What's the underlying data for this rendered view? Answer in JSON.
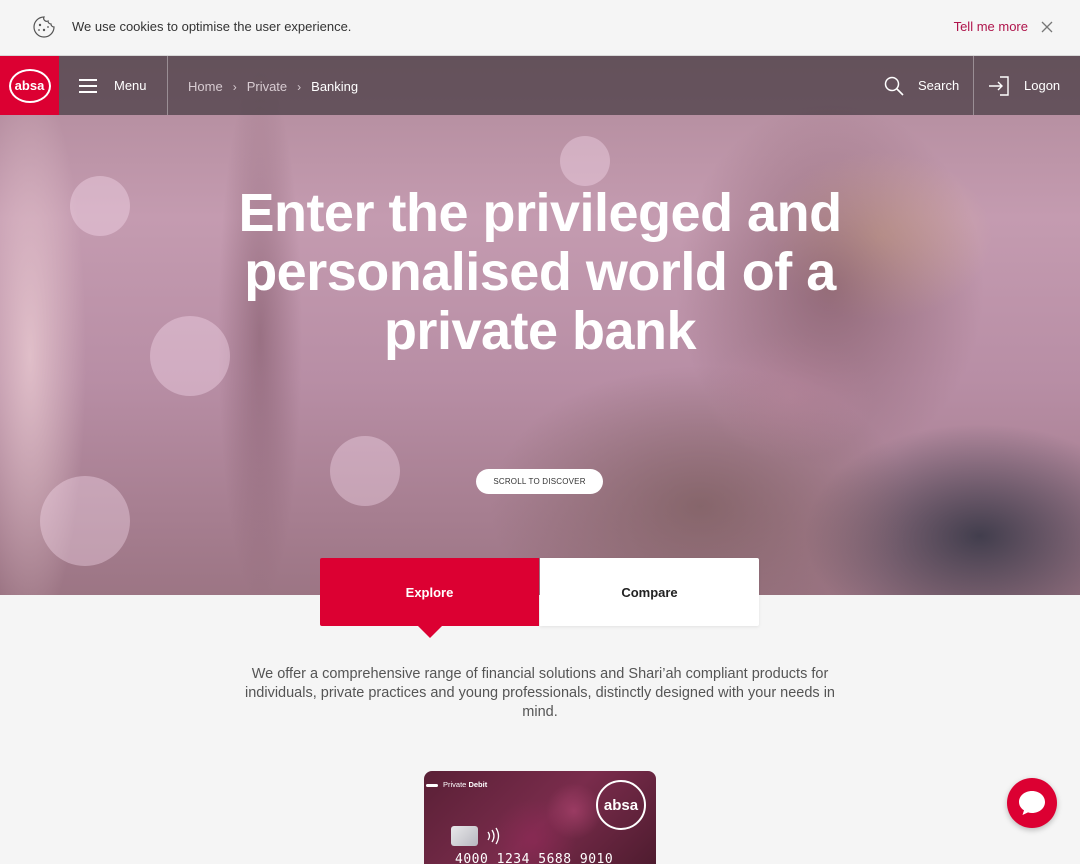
{
  "cookie_bar": {
    "message": "We use cookies to optimise the user experience.",
    "link_label": "Tell me more",
    "icons": {
      "cookie": "cookie-icon",
      "close": "close-icon"
    }
  },
  "navbar": {
    "logo_text": "absa",
    "menu_label": "Menu",
    "breadcrumb": [
      "Home",
      "Private",
      "Banking"
    ],
    "search_label": "Search",
    "logon_label": "Logon",
    "icons": {
      "menu": "hamburger-icon",
      "search": "search-icon",
      "logon": "logon-icon"
    }
  },
  "hero": {
    "title_lines": [
      "Enter the privileged and",
      "personalised world of a",
      "private bank"
    ],
    "scroll_label": "SCROLL TO DISCOVER"
  },
  "tabs": [
    {
      "label": "Explore",
      "active": true
    },
    {
      "label": "Compare",
      "active": false
    }
  ],
  "intro_text": "We offer a comprehensive range of financial solutions and Shari’ah compliant products for individuals, private practices and young professionals, distinctly designed with your needs in mind.",
  "card": {
    "type_prefix": "Private",
    "type_bold": "Debit",
    "logo_text": "absa",
    "contactless_symbol": "))))",
    "number": "4000 1234 5688 9010"
  },
  "chat": {
    "icon": "chat-bubble-icon"
  },
  "colors": {
    "brand_red": "#dc0032",
    "link_red": "#af144b"
  }
}
